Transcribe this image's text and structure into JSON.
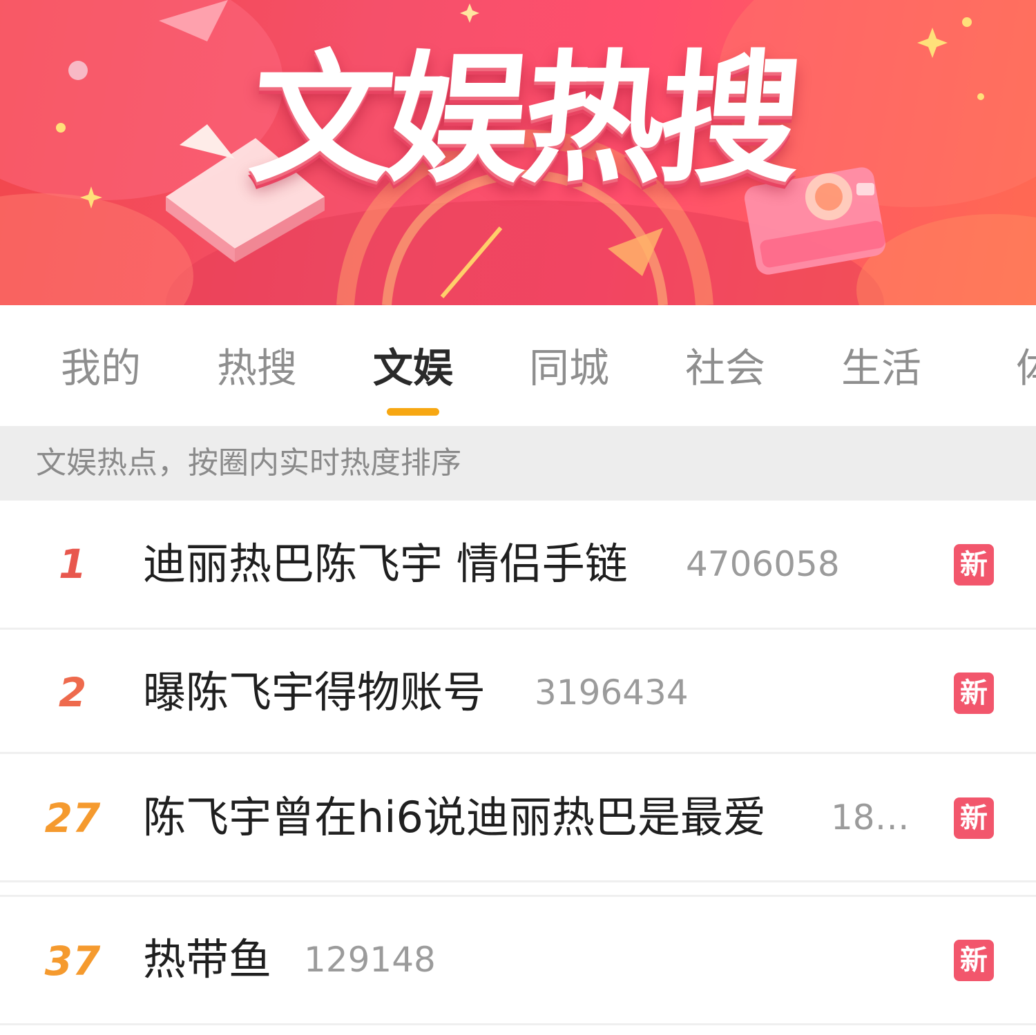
{
  "banner": {
    "title": "文娱热搜"
  },
  "tabs": [
    {
      "label": "我的"
    },
    {
      "label": "热搜"
    },
    {
      "label": "文娱",
      "active": true
    },
    {
      "label": "同城"
    },
    {
      "label": "社会"
    },
    {
      "label": "生活"
    },
    {
      "label": "体"
    }
  ],
  "info": {
    "text": "文娱热点，按圈内实时热度排序"
  },
  "list": [
    {
      "rank": "1",
      "title": "迪丽热巴陈飞宇 情侣手链",
      "heat": "4706058",
      "badge": "新",
      "rank_color": "#e8574d"
    },
    {
      "rank": "2",
      "title": "曝陈飞宇得物账号",
      "heat": "3196434",
      "badge": "新",
      "rank_color": "#ee6a4d"
    },
    {
      "rank": "27",
      "title": "陈飞宇曾在hi6说迪丽热巴是最爱",
      "heat": "18…",
      "badge": "新",
      "rank_color": "#f59a2e"
    },
    {
      "rank": "37",
      "title": "热带鱼",
      "heat": "129148",
      "badge": "新",
      "rank_color": "#f59a2e"
    }
  ],
  "colors": {
    "accent": "#f7a712",
    "badge": "#f2566c",
    "banner": "#f5506a"
  }
}
